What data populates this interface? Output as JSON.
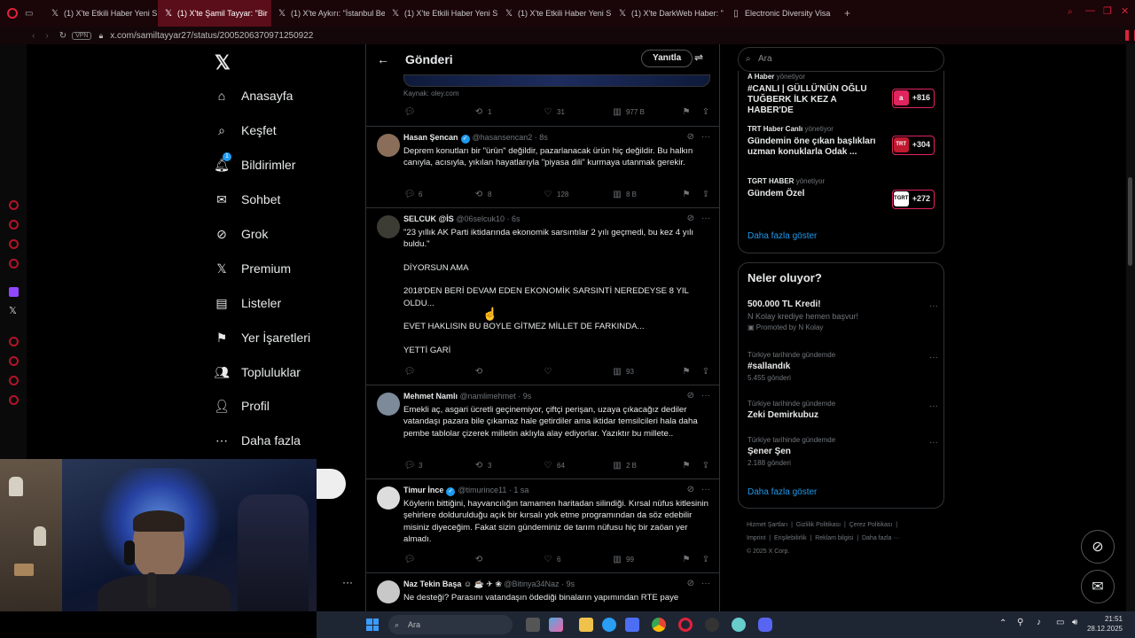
{
  "browser": {
    "tabs": [
      {
        "label": "(1) X'te Etkili Haber Yeni S"
      },
      {
        "label": "(1) X'te Şamil Tayyar: \"Bir"
      },
      {
        "label": "(1) X'te Aykırı: \"İstanbul Be"
      },
      {
        "label": "(1) X'te Etkili Haber Yeni S"
      },
      {
        "label": "(1) X'te Etkili Haber Yeni S"
      },
      {
        "label": "(1) X'te DarkWeb Haber: \""
      },
      {
        "label": "Electronic Diversity Visa"
      }
    ],
    "url": "x.com/samiltayyar27/status/2005206370971250922",
    "vpn_label": "VPN",
    "accent": "#b3142a"
  },
  "nav": {
    "items": [
      {
        "label": "Anasayfa",
        "icon": "home-icon"
      },
      {
        "label": "Keşfet",
        "icon": "search-icon"
      },
      {
        "label": "Bildirimler",
        "icon": "bell-icon",
        "badge": "1"
      },
      {
        "label": "Sohbet",
        "icon": "mail-icon"
      },
      {
        "label": "Grok",
        "icon": "grok-icon"
      },
      {
        "label": "Premium",
        "icon": "x-icon"
      },
      {
        "label": "Listeler",
        "icon": "list-icon"
      },
      {
        "label": "Yer İşaretleri",
        "icon": "bookmark-icon"
      },
      {
        "label": "Topluluklar",
        "icon": "people-icon"
      },
      {
        "label": "Profil",
        "icon": "person-icon"
      },
      {
        "label": "Daha fazla",
        "icon": "more-icon"
      }
    ]
  },
  "feed": {
    "title": "Gönderi",
    "reply_button": "Yanıtla",
    "source": "Kaynak: oley.com",
    "main_actions": {
      "replies": "",
      "reposts": "1",
      "likes": "31",
      "views": "977 B"
    },
    "tweets": [
      {
        "name": "Hasan Şencan",
        "verified": true,
        "handle": "@hasansencan2",
        "time": "· 8s",
        "text": "Deprem konutları bir \"ürün\" değildir, pazarlanacak ürün hiç değildir. Bu halkın canıyla, acısıyla, yıkılan hayatlarıyla \"piyasa dili\" kurmaya utanmak gerekir.",
        "replies": "6",
        "reposts": "8",
        "likes": "128",
        "views": "8 B"
      },
      {
        "name": "SELCUK @İS",
        "verified": false,
        "handle": "@06selcuk10",
        "time": "· 6s",
        "text": "\"23 yıllık AK Parti iktidarında ekonomik sarsıntılar 2 yılı geçmedi, bu kez 4 yılı buldu.\"\n\nDİYORSUN AMA\n\n2018'DEN BERİ DEVAM EDEN EKONOMİK SARSINTİ NEREDEYSE 8 YIL OLDU...\n\nEVET HAKLISIN BU BOYLE GİTMEZ MİLLET DE FARKINDA...\n\nYETTİ GARİ",
        "replies": "",
        "reposts": "",
        "likes": "",
        "views": "93"
      },
      {
        "name": "Mehmet Namlı",
        "verified": false,
        "handle": "@namlimehmet",
        "time": "· 9s",
        "text": "Emekli aç, asgari ücretli geçinemiyor, çiftçi perişan, uzaya çıkacağız dediler vatandaşı pazara bile çıkamaz hale getirdiler ama iktidar temsilcileri hala daha pembe tablolar çizerek milletin aklıyla alay ediyorlar. Yazıktır bu millete..",
        "replies": "3",
        "reposts": "3",
        "likes": "64",
        "views": "2 B"
      },
      {
        "name": "Timur İnce",
        "verified": true,
        "handle": "@timurince11",
        "time": "· 1 sa",
        "text": "Köylerin bittiğini, hayvancılığın tamamen haritadan silindiği. Kırsal nüfus kitlesinin şehirlere doldurulduğu açık bir kırsalı yok etme programından da söz edebilir misiniz diyeceğim. Fakat sizin gündeminiz de tarım nüfusu hiç bir zaöan yer almadı.",
        "replies": "",
        "reposts": "",
        "likes": "6",
        "views": "99"
      },
      {
        "name": "Naz Tekin Başa",
        "verified": false,
        "handle": "@Bitinya34Naz",
        "time": "· 9s",
        "text": "Ne desteği? Parasını vatandaşın ödediği binaların yapımından RTE paye",
        "replies": "",
        "reposts": "",
        "likes": "",
        "views": ""
      }
    ]
  },
  "right": {
    "search_placeholder": "Ara",
    "live": [
      {
        "who": "A Haber",
        "role": "yönetiyor",
        "headline": "#CANLI | GÜLLÜ'NÜN OĞLU TUĞBERK İLK KEZ A HABER'DE",
        "count": "+816",
        "logo": "a",
        "logo_color": "#e0245e"
      },
      {
        "who": "TRT Haber Canlı",
        "role": "yönetiyor",
        "headline": "Gündemin öne çıkan başlıkları uzman konuklarla Odak ...",
        "count": "+304",
        "logo": "TRT",
        "logo_color": "#c0182f"
      },
      {
        "who": "TGRT HABER",
        "role": "yönetiyor",
        "headline": "Gündem Özel",
        "count": "+272",
        "logo": "TGRT",
        "logo_color": "#ffffff"
      }
    ],
    "show_more_1": "Daha fazla göster",
    "whats_happening": "Neler oluyor?",
    "promo": {
      "title": "500.000 TL Kredi!",
      "sub": "N Kolay krediye hemen başvur!",
      "promoted": "Promoted by N Kolay"
    },
    "trends": [
      {
        "context": "Türkiye tarihinde gündemde",
        "topic": "#sallandık",
        "count": "5.455 gönderi"
      },
      {
        "context": "Türkiye tarihinde gündemde",
        "topic": "Zeki Demirkubuz",
        "count": ""
      },
      {
        "context": "Türkiye tarihinde gündemde",
        "topic": "Şener Şen",
        "count": "2.188 gönderi"
      }
    ],
    "show_more_2": "Daha fazla göster",
    "footer": [
      "Hizmet Şartları",
      "Gizlilik Politikası",
      "Çerez Politikası",
      "Imprint",
      "Erişilebilirlik",
      "Reklam bilgisi",
      "Daha fazla ···",
      "© 2025 X Corp."
    ]
  },
  "taskbar": {
    "search": "Ara",
    "time": "21:51",
    "date": "28.12.2025"
  }
}
